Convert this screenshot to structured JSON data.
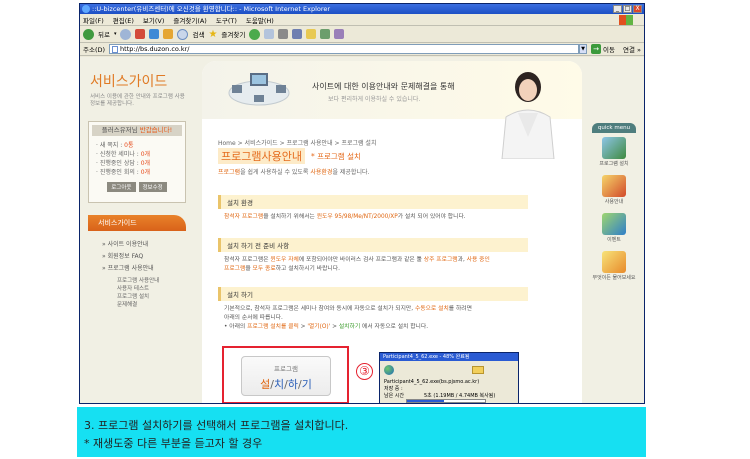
{
  "window": {
    "title": "::U-bizcenter(유비즈센터)에 오신것을 환영합니다:: - Microsoft Internet Explorer",
    "controls": [
      "_",
      "□",
      "X"
    ]
  },
  "menu": [
    "파일(F)",
    "편집(E)",
    "보기(V)",
    "즐겨찾기(A)",
    "도구(T)",
    "도움말(H)"
  ],
  "toolbar": {
    "back": "뒤로",
    "search": "검색",
    "favorites": "즐겨찾기"
  },
  "address": {
    "label": "주소(D)",
    "url": "http://bs.duzon.co.kr/",
    "go": "이동",
    "links": "연결 »"
  },
  "left": {
    "title": "서비스가이드",
    "subtitle": "서비스 이용에 관한 안내와 프로그램 사용 정보를 제공합니다.",
    "member": {
      "title": "플러스유저님",
      "title_accent": "반갑습니다!",
      "items": [
        {
          "label": "새 쪽지 :",
          "value": "0통"
        },
        {
          "label": "신청한 세미나 :",
          "value": "0개"
        },
        {
          "label": "진행중인 상담 :",
          "value": "0개"
        },
        {
          "label": "진행중인 회의 :",
          "value": "0개"
        }
      ],
      "buttons": [
        "로그아웃",
        "정보수정"
      ]
    },
    "service_header": "서비스가이드",
    "service_items": [
      "사이트 이용안내",
      "회원정보 FAQ",
      "프로그램 사용안내"
    ],
    "service_sub": [
      "프로그램 사용안내",
      "사용자 테스트",
      "프로그램 설치",
      "문제해결"
    ]
  },
  "banner": {
    "headline": "사이트에 대한 이용안내와 문제해결을 통해",
    "sub": "보다 편리하게 이용하실 수 있습니다."
  },
  "breadcrumb": "Home > 서비스가이드 > 프로그램 사용안내 > 프로그램 설치",
  "page_title": "프로그램사용안내",
  "page_subtitle": "* 프로그램 설치",
  "page_desc": {
    "p1": "프로그램",
    "p2": "을 쉽게 사용하실 수 있도록 ",
    "p3": "사용환경",
    "p4": "을 제공합니다."
  },
  "sections": [
    {
      "heading": "설치 환경",
      "line1_a": "참석자 프로그램",
      "line1_b": "을 설치하기 위해서는 ",
      "line1_c": "윈도우 95/98/Me/NT/2000/XP",
      "line1_d": "가 설치 되어 있어야 합니다."
    },
    {
      "heading": "설치 하기 전 준비 사항",
      "l1_a": "참석자 프로그램은 ",
      "l1_b": "윈도우 자체",
      "l1_c": "에 포함되어야만 바이러스 검사 프로그램과 같은 툴 ",
      "l1_d": "상주 프로그램",
      "l1_e": "과, ",
      "l1_f": "사용 중인",
      "l2_a": "프로그램",
      "l2_b": "을 ",
      "l2_c": "모두 종료",
      "l2_d": "하고 설치하시기 바랍니다."
    },
    {
      "heading": "설치 하기",
      "l1_a": "기본적으로, 참석자 프로그램은 세미나 참여와 동시에 자동으로 설치가 되지만, ",
      "l1_b": "수동으로 설치",
      "l1_c": "를 하려면",
      "l2": "아래의 순서에 따릅니다.",
      "l3_a": "• 아래의 ",
      "l3_b": "프로그램 설치를 클릭",
      "l3_c": " > ",
      "l3_d": "'열기(O)'",
      "l3_e": " > ",
      "l3_f": "설치하기",
      "l3_g": " 에서 자동으로 설치 합니다."
    }
  ],
  "install_button": {
    "line1": "프로그램",
    "p1": "설",
    "sep": "/",
    "p2": "치",
    "p3": "하",
    "p4": "기"
  },
  "step_number": "③",
  "dialog": {
    "title": "Participant4_5_62.exe - 48% 완료됨",
    "line1": "Participant4_5_62.exe(bs.pjsmo.ac.kr)",
    "line2": "저장 중 :",
    "line3": "남은 시간",
    "line4": "5초 (1.19MB / 4.74MB 복사됨)",
    "progress": 0.48
  },
  "quickmenu": {
    "title": "quick menu",
    "items": [
      "프로그램 설치",
      "사용안내",
      "이벤트",
      "무엇이든 물어보세요"
    ]
  },
  "caption": {
    "line1": "3. 프로그램 설치하기를 선택해서 프로그램을 설치합니다.",
    "line2": "* 재생도중 다른 부분을 듣고자 할 경우"
  },
  "colors": {
    "accent": "#e56b1c",
    "caption_bg": "#16e0f2",
    "highlight_border": "#e52230"
  }
}
